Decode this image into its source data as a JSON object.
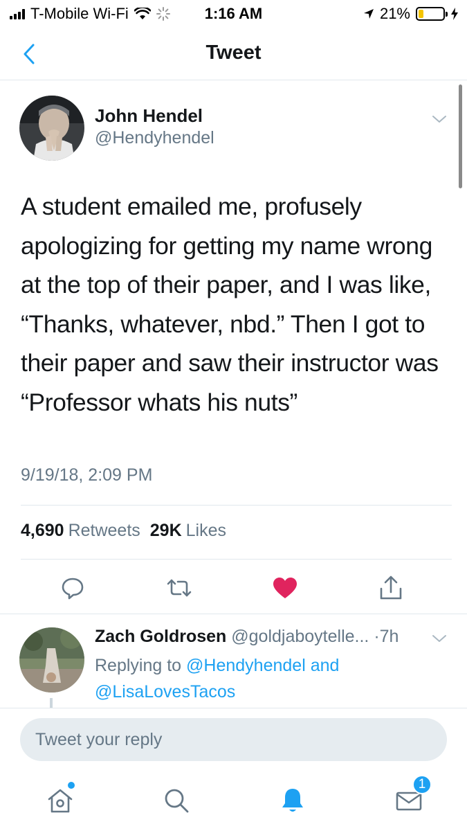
{
  "status_bar": {
    "carrier": "T-Mobile Wi-Fi",
    "time": "1:16 AM",
    "battery_percent": "21%",
    "battery_level": 0.21,
    "battery_color": "#f5c400"
  },
  "nav": {
    "title": "Tweet",
    "back_icon": "chevron-left-icon"
  },
  "tweet": {
    "author_name": "John Hendel",
    "author_handle": "@Hendyhendel",
    "text": "A student emailed me, profusely apologizing for getting my name wrong at the top of their paper, and I was like, “Thanks, whatever, nbd.” Then I got to their paper and saw their instructor was “Professor whats his nuts”",
    "timestamp": "9/19/18, 2:09 PM",
    "retweets_count": "4,690",
    "retweets_label": "Retweets",
    "likes_count": "29K",
    "likes_label": "Likes",
    "liked": true,
    "like_color": "#e0245e",
    "actions": [
      "reply-icon",
      "retweet-icon",
      "heart-icon",
      "share-icon"
    ]
  },
  "reply": {
    "name": "Zach Goldrosen",
    "handle": "@goldjaboytelle...",
    "separator": "·",
    "age": "7h",
    "replying_prefix": "Replying to",
    "mention_1": "@Hendyhendel",
    "conjunction": "and",
    "mention_2": "@LisaLovesTacos"
  },
  "composer": {
    "placeholder": "Tweet your reply"
  },
  "tab_bar": {
    "items": [
      "home-icon",
      "search-icon",
      "notifications-icon",
      "messages-icon"
    ],
    "messages_badge": "1",
    "active_color": "#1da1f2"
  }
}
